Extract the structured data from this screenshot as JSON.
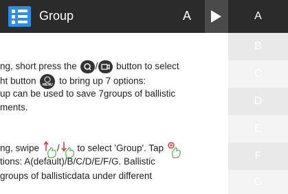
{
  "header": {
    "title": "Group",
    "current_value": "A"
  },
  "options": [
    "A",
    "B",
    "C",
    "D",
    "E",
    "F",
    "G"
  ],
  "selected_option": "A",
  "instructions": {
    "line1_a": "ng, short press the",
    "line1_sep": "/",
    "line1_b": "button to select",
    "line2_a": "ht button",
    "line2_menu_label": "MENU",
    "line2_b": "to bring up 7 options:",
    "line3": "up can be used to save 7groups of ballistic",
    "line4": "ments.",
    "line5_a": "ng, swipe",
    "line5_sep": "/",
    "line5_b": "to select 'Group'. Tap",
    "line6": "tions: A(default)/B/C/D/E/F/G. Ballistic",
    "line7": "groups of ballisticdata under different"
  }
}
